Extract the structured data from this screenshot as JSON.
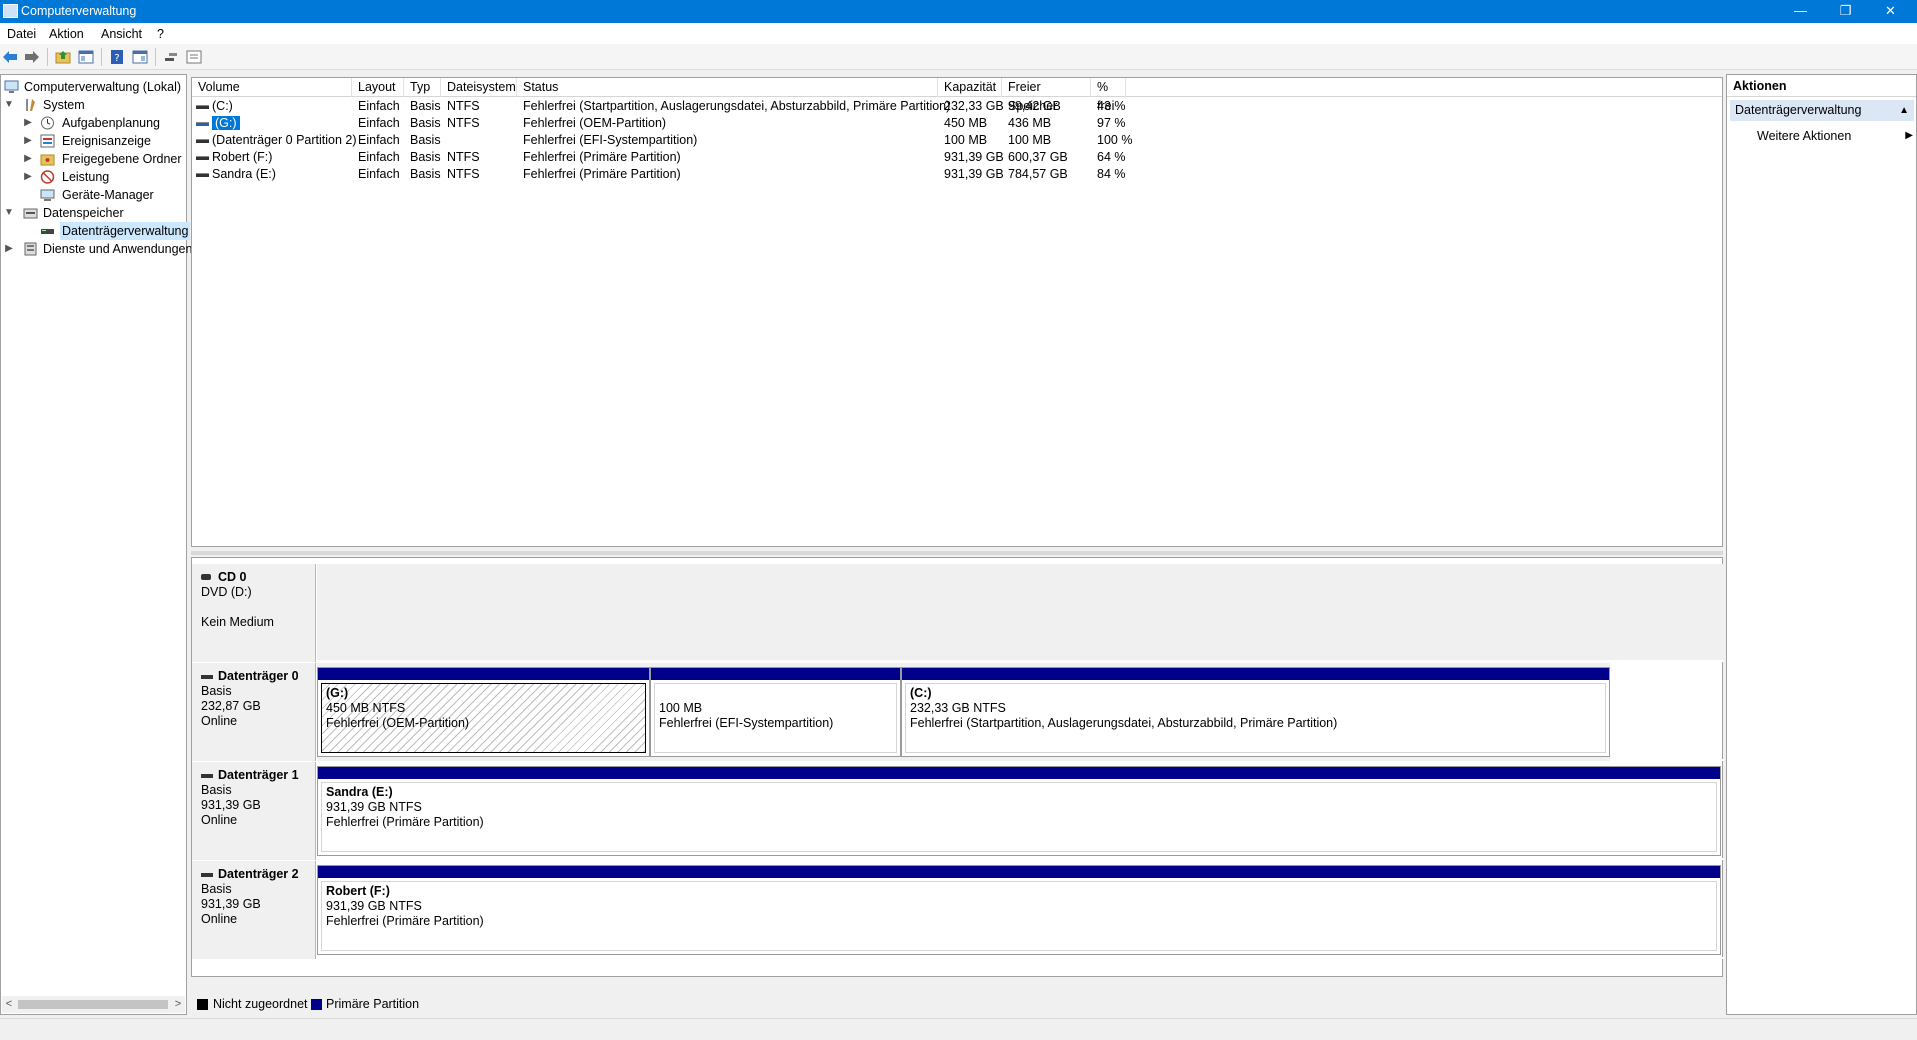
{
  "window": {
    "title": "Computerverwaltung",
    "buttons": {
      "minimize": "—",
      "restore": "❐",
      "close": "✕"
    }
  },
  "menu": [
    "Datei",
    "Aktion",
    "Ansicht",
    "?"
  ],
  "toolbar": [
    "back-arrow",
    "forward-arrow",
    "up-folder",
    "show-hide-console-tree",
    "help",
    "properties",
    "connect",
    "list-view"
  ],
  "tree": {
    "root": "Computerverwaltung (Lokal)",
    "system": "System",
    "aufgaben": "Aufgabenplanung",
    "ereignis": "Ereignisanzeige",
    "freigegeben": "Freigegebene Ordner",
    "leistung": "Leistung",
    "geraete": "Geräte-Manager",
    "datenspeicher": "Datenspeicher",
    "datentraeger": "Datenträgerverwaltung",
    "dienste": "Dienste und Anwendungen"
  },
  "volumes": {
    "columns": [
      "Volume",
      "Layout",
      "Typ",
      "Dateisystem",
      "Status",
      "Kapazität",
      "Freier Speicher",
      "% frei"
    ],
    "rows": [
      [
        "(C:)",
        "Einfach",
        "Basis",
        "NTFS",
        "Fehlerfrei (Startpartition, Auslagerungsdatei, Absturzabbild, Primäre Partition)",
        "232,33 GB",
        "99,42 GB",
        "43 %"
      ],
      [
        "(G:)",
        "Einfach",
        "Basis",
        "NTFS",
        "Fehlerfrei (OEM-Partition)",
        "450 MB",
        "436 MB",
        "97 %"
      ],
      [
        "(Datenträger 0 Partition 2)",
        "Einfach",
        "Basis",
        "",
        "Fehlerfrei (EFI-Systempartition)",
        "100 MB",
        "100 MB",
        "100 %"
      ],
      [
        "Robert (F:)",
        "Einfach",
        "Basis",
        "NTFS",
        "Fehlerfrei (Primäre Partition)",
        "931,39 GB",
        "600,37 GB",
        "64 %"
      ],
      [
        "Sandra (E:)",
        "Einfach",
        "Basis",
        "NTFS",
        "Fehlerfrei (Primäre Partition)",
        "931,39 GB",
        "784,57 GB",
        "84 %"
      ]
    ]
  },
  "disks": {
    "cd0": {
      "name": "CD 0",
      "line1": "DVD (D:)",
      "line2": "",
      "line3": "Kein Medium"
    },
    "disk0": {
      "name": "Datenträger 0",
      "type": "Basis",
      "size": "232,87 GB",
      "state": "Online",
      "parts": [
        {
          "name": "(G:)",
          "size": "450 MB NTFS",
          "status": "Fehlerfrei (OEM-Partition)"
        },
        {
          "name": "",
          "size": "100 MB",
          "status": "Fehlerfrei (EFI-Systempartition)"
        },
        {
          "name": "(C:)",
          "size": "232,33 GB NTFS",
          "status": "Fehlerfrei (Startpartition, Auslagerungsdatei, Absturzabbild, Primäre Partition)"
        }
      ]
    },
    "disk1": {
      "name": "Datenträger 1",
      "type": "Basis",
      "size": "931,39 GB",
      "state": "Online",
      "parts": [
        {
          "name": "Sandra  (E:)",
          "size": "931,39 GB NTFS",
          "status": "Fehlerfrei (Primäre Partition)"
        }
      ]
    },
    "disk2": {
      "name": "Datenträger 2",
      "type": "Basis",
      "size": "931,39 GB",
      "state": "Online",
      "parts": [
        {
          "name": "Robert  (F:)",
          "size": "931,39 GB NTFS",
          "status": "Fehlerfrei (Primäre Partition)"
        }
      ]
    }
  },
  "legend": {
    "unallocated": "Nicht zugeordnet",
    "unallocated_color": "#000000",
    "primary": "Primäre Partition",
    "primary_color": "#00008b"
  },
  "actions": {
    "header": "Aktionen",
    "section": "Datenträgerverwaltung",
    "item": "Weitere Aktionen"
  }
}
